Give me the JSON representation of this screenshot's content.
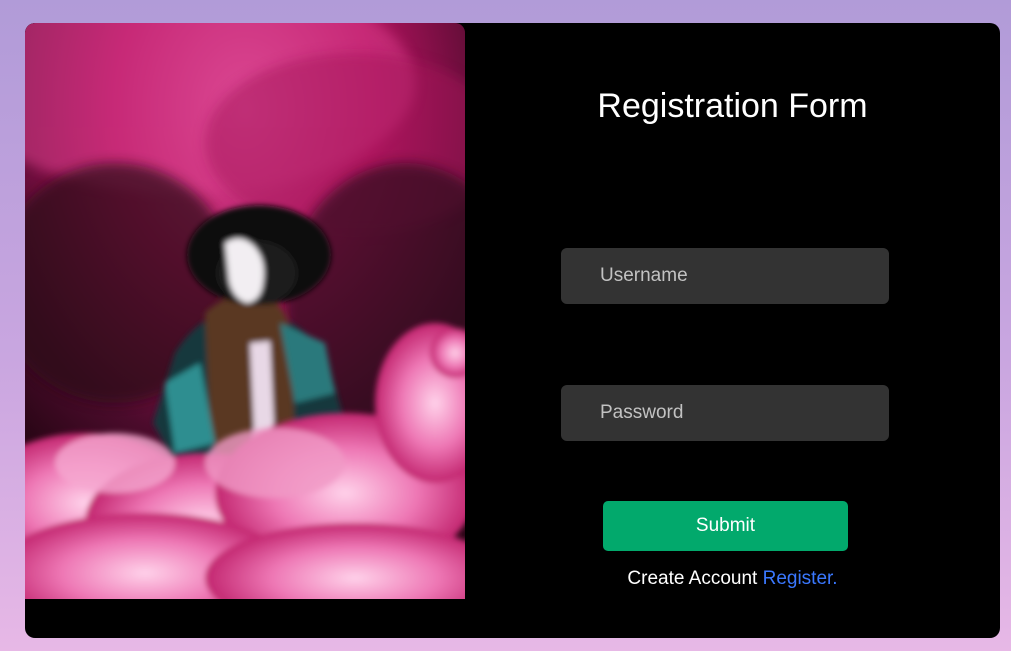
{
  "form": {
    "title": "Registration Form",
    "username_placeholder": "Username",
    "password_placeholder": "Password",
    "submit_label": "Submit",
    "footer_text": "Create Account",
    "register_link": "Register."
  },
  "colors": {
    "background_gradient_top": "#b19bd8",
    "background_gradient_bottom": "#e7b8e6",
    "card": "#000000",
    "input": "#333333",
    "submit": "#02a96c",
    "link": "#3a78ff"
  }
}
